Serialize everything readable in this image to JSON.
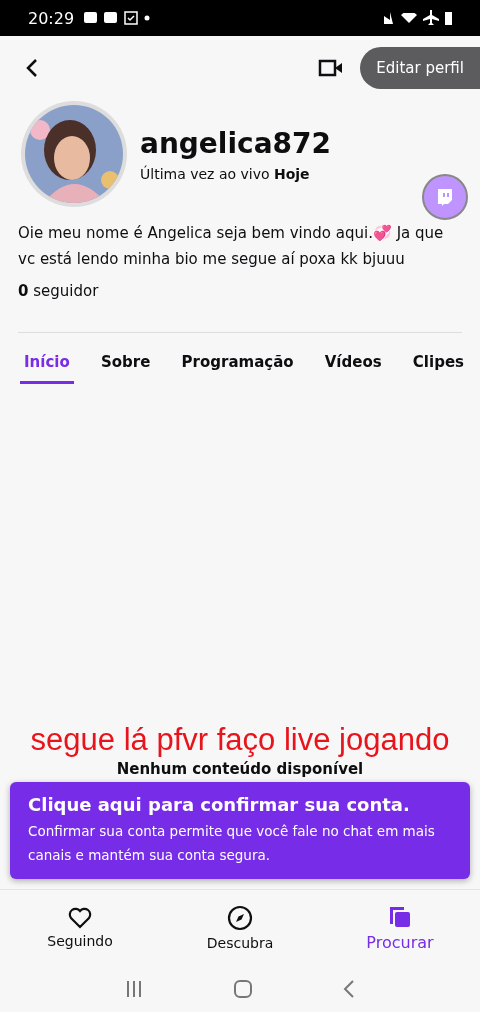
{
  "status_bar": {
    "time": "20:29"
  },
  "header": {
    "edit_button": "Editar perfil"
  },
  "profile": {
    "username": "angelica872",
    "last_live": "Última vez ao vivo **Hoje**",
    "bio": "Oie meu nome é Angelica seja bem vindo aqui.💞 Ja que vc está lendo minha bio me segue aí poxa kk bjuuu",
    "followers": "**0** seguidor"
  },
  "tabs": [
    {
      "label": "Início",
      "selected": true
    },
    {
      "label": "Sobre",
      "selected": false
    },
    {
      "label": "Programação",
      "selected": false
    },
    {
      "label": "Vídeos",
      "selected": false
    },
    {
      "label": "Clipes",
      "selected": false
    }
  ],
  "caption": "segue lá pfvr faço live jogando",
  "empty_message": "Nenhum conteúdo disponível",
  "banner": {
    "title": "Clique aqui para confirmar sua conta.",
    "text": "Confirmar sua conta permite que você fale no chat em mais canais e mantém sua conta segura."
  },
  "bottom_nav": [
    {
      "kind": "heart",
      "label": "Seguindo",
      "selected": false
    },
    {
      "kind": "compass",
      "label": "Descubra",
      "selected": false
    },
    {
      "kind": "copy",
      "label": "Procurar",
      "selected": true
    }
  ]
}
